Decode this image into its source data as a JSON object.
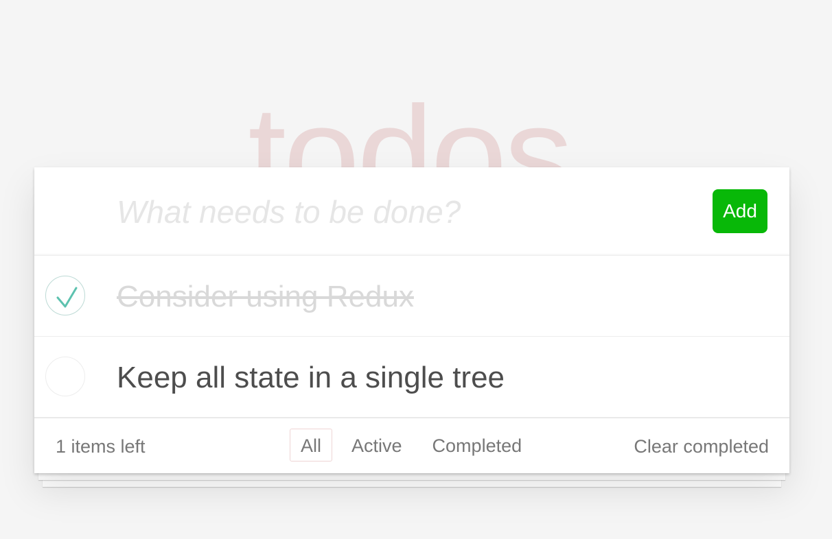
{
  "header": {
    "title": "todos"
  },
  "new_todo": {
    "placeholder": "What needs to be done?",
    "value": "",
    "add_label": "Add"
  },
  "todos": [
    {
      "text": "Consider using Redux",
      "completed": true
    },
    {
      "text": "Keep all state in a single tree",
      "completed": false
    }
  ],
  "footer": {
    "count_label": "1 items left",
    "filters": [
      {
        "label": "All",
        "selected": true
      },
      {
        "label": "Active",
        "selected": false
      },
      {
        "label": "Completed",
        "selected": false
      }
    ],
    "clear_label": "Clear completed"
  },
  "colors": {
    "title": "#efd5d5",
    "add_button": "#08b808",
    "check": "#5dc2af",
    "completed_text": "#d9d9d9"
  }
}
